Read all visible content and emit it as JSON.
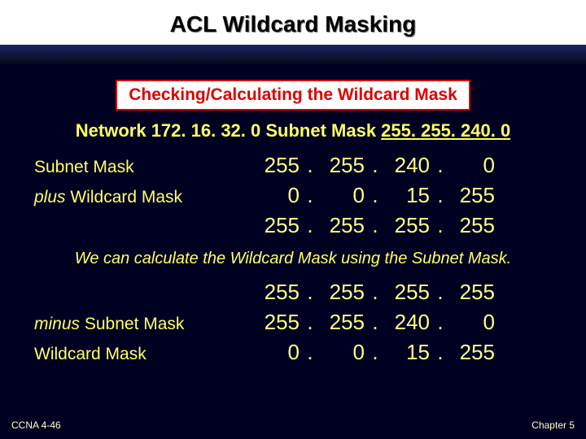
{
  "title": "ACL Wildcard Masking",
  "box_heading": "Checking/Calculating the Wildcard Mask",
  "network_line_prefix": "Network 172. 16. 32. 0   Subnet Mask ",
  "network_subnet": "255. 255. 240. 0",
  "rows1": {
    "subnet_label": "Subnet Mask",
    "plus_prefix": "plus",
    "plus_rest": "  Wildcard Mask",
    "subnet": [
      "255",
      "255",
      "240",
      "0"
    ],
    "wildcard": [
      "0",
      "0",
      "15",
      "255"
    ],
    "sum": [
      "255",
      "255",
      "255",
      "255"
    ]
  },
  "explain_text": "We can calculate the Wildcard Mask using the Subnet Mask.",
  "rows2": {
    "all255": [
      "255",
      "255",
      "255",
      "255"
    ],
    "minus_prefix": "minus",
    "minus_rest": "   Subnet Mask",
    "subnet": [
      "255",
      "255",
      "240",
      "0"
    ],
    "wildcard_label": "Wildcard Mask",
    "wildcard": [
      "0",
      "0",
      "15",
      "255"
    ]
  },
  "footer_left": "CCNA 4-46",
  "footer_right": "Chapter 5",
  "chart_data": {
    "type": "table",
    "title": "Wildcard Mask Calculation",
    "check": {
      "subnet_mask": [
        255,
        255,
        240,
        0
      ],
      "wildcard_mask": [
        0,
        0,
        15,
        255
      ],
      "sum": [
        255,
        255,
        255,
        255
      ]
    },
    "calculate": {
      "all_ones": [
        255,
        255,
        255,
        255
      ],
      "subnet_mask": [
        255,
        255,
        240,
        0
      ],
      "wildcard_mask": [
        0,
        0,
        15,
        255
      ]
    }
  }
}
